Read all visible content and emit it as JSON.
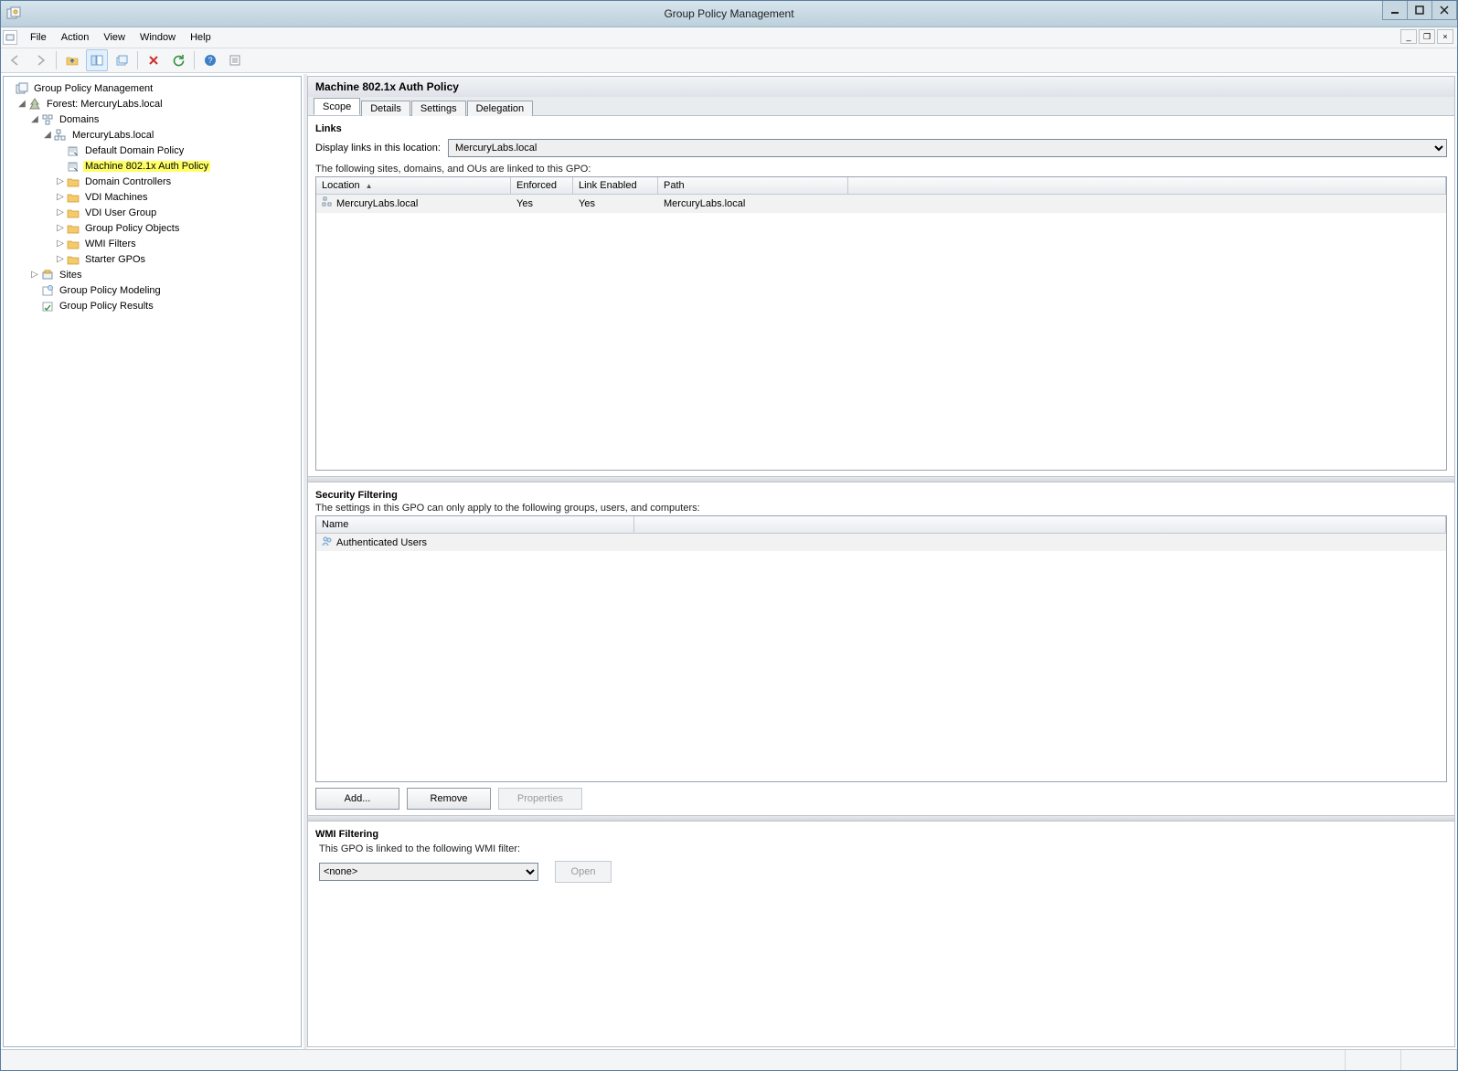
{
  "window": {
    "title": "Group Policy Management"
  },
  "menu": {
    "file": "File",
    "action": "Action",
    "view": "View",
    "window": "Window",
    "help": "Help"
  },
  "toolbar_icons": [
    "back",
    "forward",
    "up",
    "show-hide-tree",
    "new-window",
    "delete",
    "refresh",
    "properties",
    "help",
    "export"
  ],
  "tree": {
    "root": "Group Policy Management",
    "forest": "Forest: MercuryLabs.local",
    "domains": "Domains",
    "domain": "MercuryLabs.local",
    "items": [
      {
        "label": "Default Domain Policy",
        "type": "gpo-link"
      },
      {
        "label": "Machine 802.1x Auth Policy",
        "type": "gpo-link",
        "highlight": true
      },
      {
        "label": "Domain Controllers",
        "type": "ou"
      },
      {
        "label": "VDI Machines",
        "type": "ou"
      },
      {
        "label": "VDI User Group",
        "type": "ou"
      },
      {
        "label": "Group Policy Objects",
        "type": "container"
      },
      {
        "label": "WMI Filters",
        "type": "container"
      },
      {
        "label": "Starter GPOs",
        "type": "container"
      }
    ],
    "sites": "Sites",
    "modeling": "Group Policy Modeling",
    "results": "Group Policy Results"
  },
  "detail": {
    "title": "Machine 802.1x Auth Policy",
    "tabs": {
      "scope": "Scope",
      "details": "Details",
      "settings": "Settings",
      "delegation": "Delegation"
    },
    "links": {
      "heading": "Links",
      "display_label": "Display links in this location:",
      "location_value": "MercuryLabs.local",
      "subtext": "The following sites, domains, and OUs are linked to this GPO:",
      "columns": {
        "location": "Location",
        "enforced": "Enforced",
        "link_enabled": "Link Enabled",
        "path": "Path"
      },
      "rows": [
        {
          "location": "MercuryLabs.local",
          "enforced": "Yes",
          "link_enabled": "Yes",
          "path": "MercuryLabs.local"
        }
      ]
    },
    "security": {
      "heading": "Security Filtering",
      "subtext": "The settings in this GPO can only apply to the following groups, users, and computers:",
      "column": "Name",
      "rows": [
        "Authenticated Users"
      ],
      "buttons": {
        "add": "Add...",
        "remove": "Remove",
        "properties": "Properties"
      }
    },
    "wmi": {
      "heading": "WMI Filtering",
      "subtext": "This GPO is linked to the following WMI filter:",
      "value": "<none>",
      "open": "Open"
    }
  }
}
